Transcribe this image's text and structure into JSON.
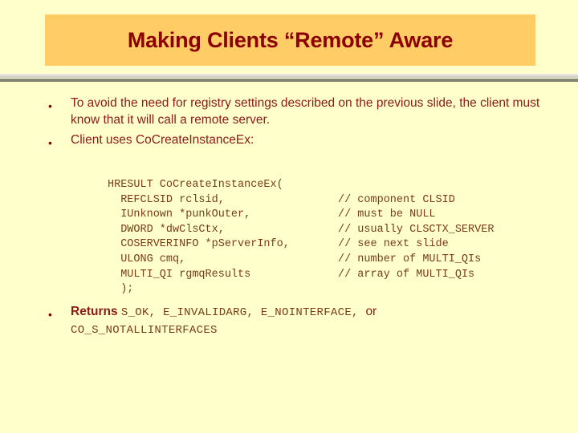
{
  "slide": {
    "title": "Making Clients “Remote” Aware",
    "background_color": "#FFFFCC",
    "title_box_color": "#FFCC66",
    "title_text_color": "#8B0000",
    "body_text_color": "#8B1A1A",
    "code_text_color": "#7A3B18"
  },
  "bullets": [
    {
      "marker": "•",
      "text": "To avoid the need for registry settings described on the previous slide, the client must know that it will call a remote server."
    },
    {
      "marker": "•",
      "text": "Client uses CoCreateInstanceEx:"
    }
  ],
  "code": {
    "lines": [
      {
        "signature": "HRESULT CoCreateInstanceEx(",
        "comment": ""
      },
      {
        "signature": "  REFCLSID rclsid,",
        "comment": "// component CLSID"
      },
      {
        "signature": "  IUnknown *punkOuter,",
        "comment": "// must be NULL"
      },
      {
        "signature": "  DWORD *dwClsCtx,",
        "comment": "// usually CLSCTX_SERVER"
      },
      {
        "signature": "  COSERVERINFO *pServerInfo,",
        "comment": "// see next slide"
      },
      {
        "signature": "  ULONG cmq,",
        "comment": "// number of MULTI_QIs"
      },
      {
        "signature": "  MULTI_QI rgmqResults",
        "comment": "// array of MULTI_QIs"
      },
      {
        "signature": "  );",
        "comment": ""
      }
    ]
  },
  "returns_bullet": {
    "marker": "•",
    "lead": "Returns",
    "codes_line1": "S_OK, E_INVALIDARG, E_NOINTERFACE,",
    "trailing": "or",
    "codes_line2": "CO_S_NOTALLINTERFACES"
  }
}
